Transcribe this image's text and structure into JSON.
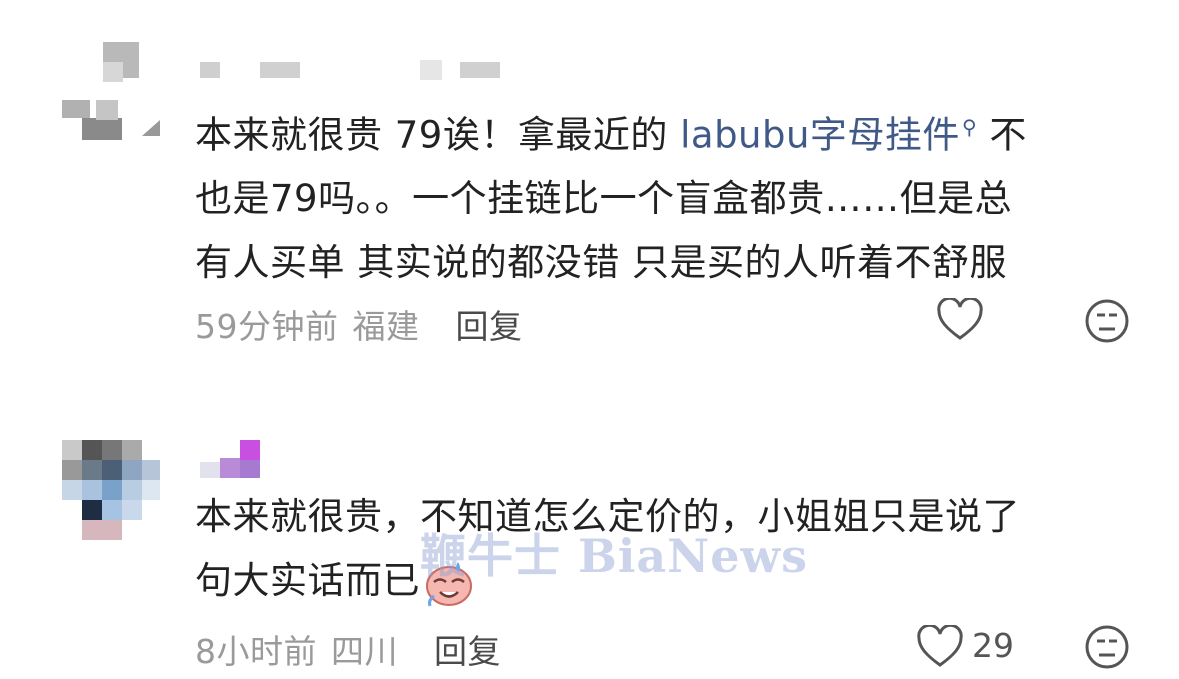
{
  "comments": [
    {
      "text_before": "本来就很贵 79诶！拿最近的 ",
      "mention": "labubu字母挂件",
      "text_line1_end": " 不",
      "text_line2": "也是79吗。。一个挂链比一个盲盒都贵……但是总",
      "text_line3": "有人买单 其实说的都没错 只是买的人听着不舒服",
      "time": "59分钟前",
      "location": "福建",
      "reply_label": "回复"
    },
    {
      "text_line1": "本来就很贵，不知道怎么定价的，小姐姐只是说了",
      "text_line2": "句大实话而已",
      "time": "8小时前",
      "location": "四川",
      "reply_label": "回复",
      "like_count": "29"
    }
  ],
  "watermark": "鞭牛士 BiaNews",
  "colors": {
    "mention": "#3f5a86",
    "meta": "#9a9a9a",
    "text": "#222222"
  }
}
